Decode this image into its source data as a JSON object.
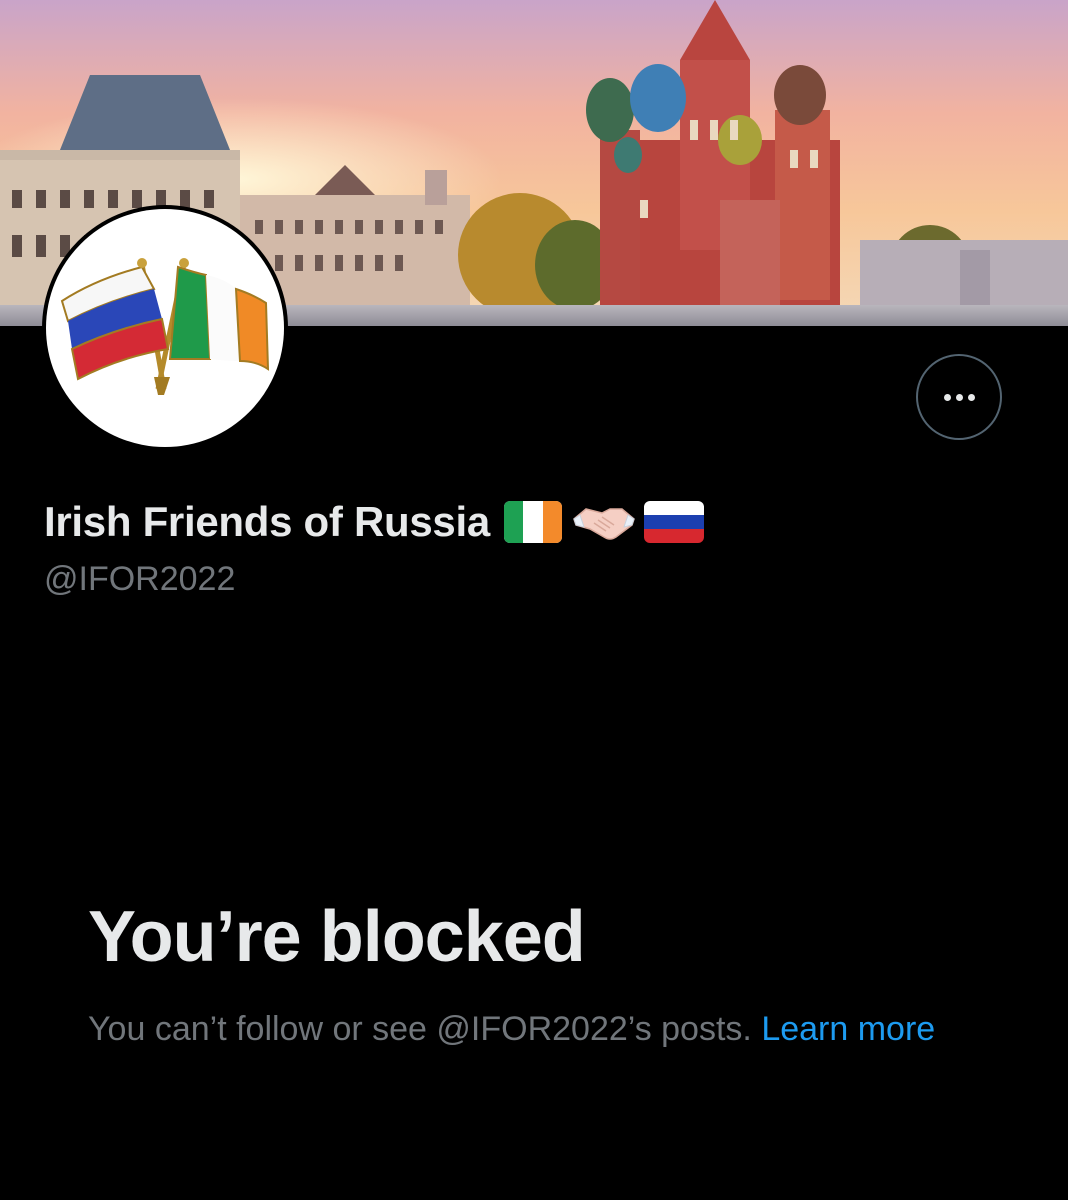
{
  "profile": {
    "display_name": "Irish Friends of Russia",
    "handle": "@IFOR2022",
    "name_emoji": [
      "flag-ireland",
      "handshake",
      "flag-russia"
    ]
  },
  "banner": {
    "description_icon": "moscow-red-square-photo"
  },
  "avatar": {
    "icon": "russia-ireland-friendship-pin"
  },
  "actions": {
    "more_icon": "ellipsis-icon"
  },
  "blocked": {
    "title": "You’re blocked",
    "message": "You can’t follow or see @IFOR2022’s posts. ",
    "learn_more": "Learn more"
  },
  "colors": {
    "background": "#000000",
    "text_primary": "#e7e9ea",
    "text_secondary": "#71767b",
    "link": "#1d9bf0",
    "border": "#536471"
  }
}
